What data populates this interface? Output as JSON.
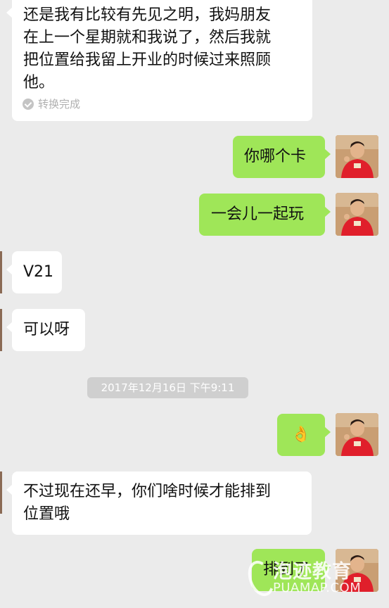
{
  "messages": [
    {
      "side": "left",
      "text": "还是我有比较有先见之明，我妈朋友在上一个星期就和我说了，然后我就把位置给我留上开业的时候过来照顾他。"
    },
    {
      "side": "right",
      "text": "你哪个卡"
    },
    {
      "side": "right",
      "text": "一会儿一起玩"
    },
    {
      "side": "left",
      "text": "V21"
    },
    {
      "side": "left",
      "text": "可以呀"
    },
    {
      "side": "right",
      "text": "👌"
    },
    {
      "side": "left",
      "text": "不过现在还早，你们啥时候才能排到位置哦"
    },
    {
      "side": "right",
      "text": "排到了"
    }
  ],
  "first_message_lines": [
    "还是我有比较有先见之明，我妈朋友",
    "在上一个星期就和我说了，然后我就",
    "把位置给我留上开业的时候过来照顾",
    "他。"
  ],
  "seventh_message_lines": [
    "不过现在还早，你们啥时候才能排到",
    "位置哦"
  ],
  "translation_status": "转换完成",
  "timestamp": "2017年12月16日 下午9:11",
  "watermark": {
    "main": "泡迹教育",
    "sub": "PUAMAP.COM"
  },
  "colors": {
    "background": "#ebebeb",
    "sent_bubble": "#9fe658",
    "received_bubble": "#ffffff",
    "timestamp_bg": "#cfcfcf"
  },
  "icons": {
    "avatar": "user-avatar-red-shirt",
    "check": "check-circle-icon"
  }
}
